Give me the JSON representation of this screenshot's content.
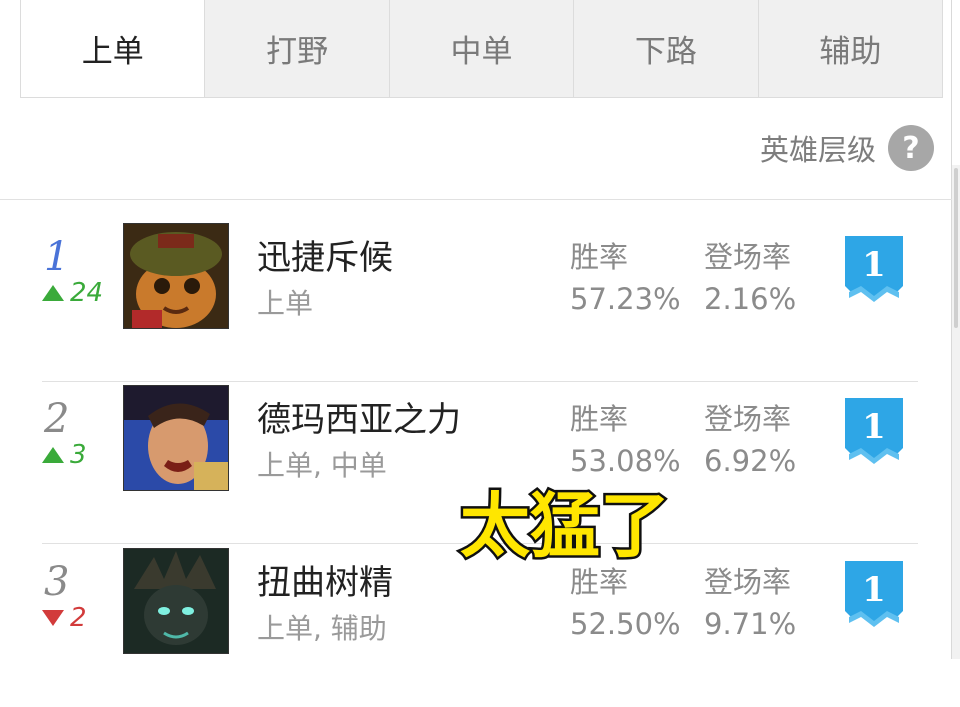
{
  "tabs": [
    {
      "label": "上单",
      "active": true
    },
    {
      "label": "打野",
      "active": false
    },
    {
      "label": "中单",
      "active": false
    },
    {
      "label": "下路",
      "active": false
    },
    {
      "label": "辅助",
      "active": false
    }
  ],
  "tier_header": {
    "label": "英雄层级",
    "help_icon": "?"
  },
  "heroes": [
    {
      "rank": "1",
      "change_dir": "up",
      "change": "24",
      "name": "迅捷斥候",
      "role": "上单",
      "win_label": "胜率",
      "win_rate": "57.23%",
      "pick_label": "登场率",
      "pick_rate": "2.16%",
      "tier": "1"
    },
    {
      "rank": "2",
      "change_dir": "up",
      "change": "3",
      "name": "德玛西亚之力",
      "role": "上单, 中单",
      "win_label": "胜率",
      "win_rate": "53.08%",
      "pick_label": "登场率",
      "pick_rate": "6.92%",
      "tier": "1"
    },
    {
      "rank": "3",
      "change_dir": "down",
      "change": "2",
      "name": "扭曲树精",
      "role": "上单, 辅助",
      "win_label": "胜率",
      "win_rate": "52.50%",
      "pick_label": "登场率",
      "pick_rate": "9.71%",
      "tier": "1"
    }
  ],
  "overlay_caption": "太猛了",
  "colors": {
    "badge_blue": "#2ea6e6",
    "up_green": "#3aaa3a",
    "down_red": "#d23b3b",
    "rank_blue": "#4a73d8",
    "caption_yellow": "#ffe600"
  }
}
